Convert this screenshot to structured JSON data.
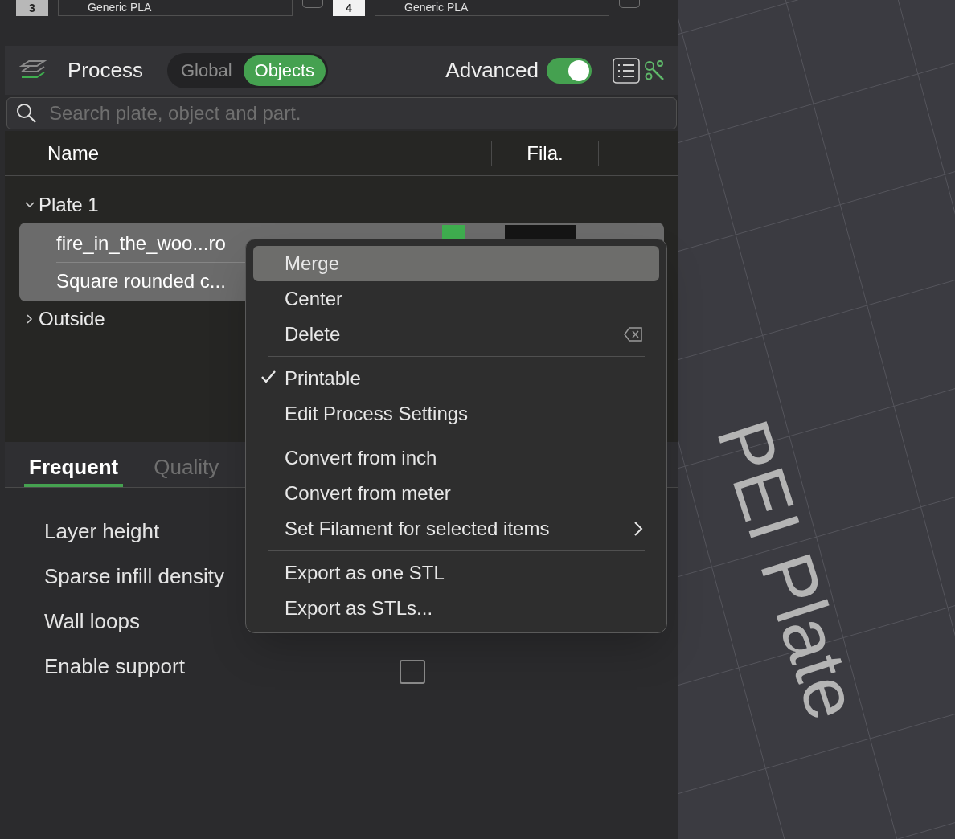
{
  "filament_slots": [
    {
      "number": "3",
      "name": "Generic PLA",
      "selected": false,
      "checked": false
    },
    {
      "number": "4",
      "name": "Generic PLA",
      "selected": true,
      "checked": false
    }
  ],
  "process": {
    "title": "Process",
    "modes": [
      {
        "label": "Global",
        "selected": false
      },
      {
        "label": "Objects",
        "selected": true
      }
    ],
    "advanced_label": "Advanced",
    "advanced_on": true
  },
  "search": {
    "placeholder": "Search plate, object and part."
  },
  "table": {
    "columns": [
      "Name",
      "",
      "Fila."
    ]
  },
  "tree": [
    {
      "label": "Plate 1",
      "expanded": true,
      "children": [
        {
          "label": "fire_in_the_woo...ro",
          "selected": true,
          "color": "#3fae4f"
        },
        {
          "label": "Square rounded c...",
          "selected": true
        }
      ]
    },
    {
      "label": "Outside",
      "expanded": false
    }
  ],
  "settings_tabs": [
    {
      "label": "Frequent",
      "selected": true
    },
    {
      "label": "Quality",
      "selected": false
    }
  ],
  "settings": [
    {
      "label": "Layer height",
      "kind": "value"
    },
    {
      "label": "Sparse infill density",
      "kind": "value"
    },
    {
      "label": "Wall loops",
      "kind": "value"
    },
    {
      "label": "Enable support",
      "kind": "checkbox",
      "checked": false
    }
  ],
  "context_menu": [
    {
      "kind": "item",
      "label": "Merge",
      "selected": true,
      "checked": false,
      "submenu": false,
      "delete_key": false
    },
    {
      "kind": "item",
      "label": "Center",
      "selected": false,
      "checked": false,
      "submenu": false,
      "delete_key": false
    },
    {
      "kind": "item",
      "label": "Delete",
      "selected": false,
      "checked": false,
      "submenu": false,
      "delete_key": true
    },
    {
      "kind": "separator"
    },
    {
      "kind": "item",
      "label": "Printable",
      "selected": false,
      "checked": true,
      "submenu": false,
      "delete_key": false
    },
    {
      "kind": "item",
      "label": "Edit Process Settings",
      "selected": false,
      "checked": false,
      "submenu": false,
      "delete_key": false
    },
    {
      "kind": "separator"
    },
    {
      "kind": "item",
      "label": "Convert from inch",
      "selected": false,
      "checked": false,
      "submenu": false,
      "delete_key": false
    },
    {
      "kind": "item",
      "label": "Convert from meter",
      "selected": false,
      "checked": false,
      "submenu": false,
      "delete_key": false
    },
    {
      "kind": "item",
      "label": "Set Filament for selected items",
      "selected": false,
      "checked": false,
      "submenu": true,
      "delete_key": false
    },
    {
      "kind": "separator"
    },
    {
      "kind": "item",
      "label": "Export as one STL",
      "selected": false,
      "checked": false,
      "submenu": false,
      "delete_key": false
    },
    {
      "kind": "item",
      "label": "Export as STLs...",
      "selected": false,
      "checked": false,
      "submenu": false,
      "delete_key": false
    }
  ],
  "viewport": {
    "plate_label": "PEI Plate"
  }
}
